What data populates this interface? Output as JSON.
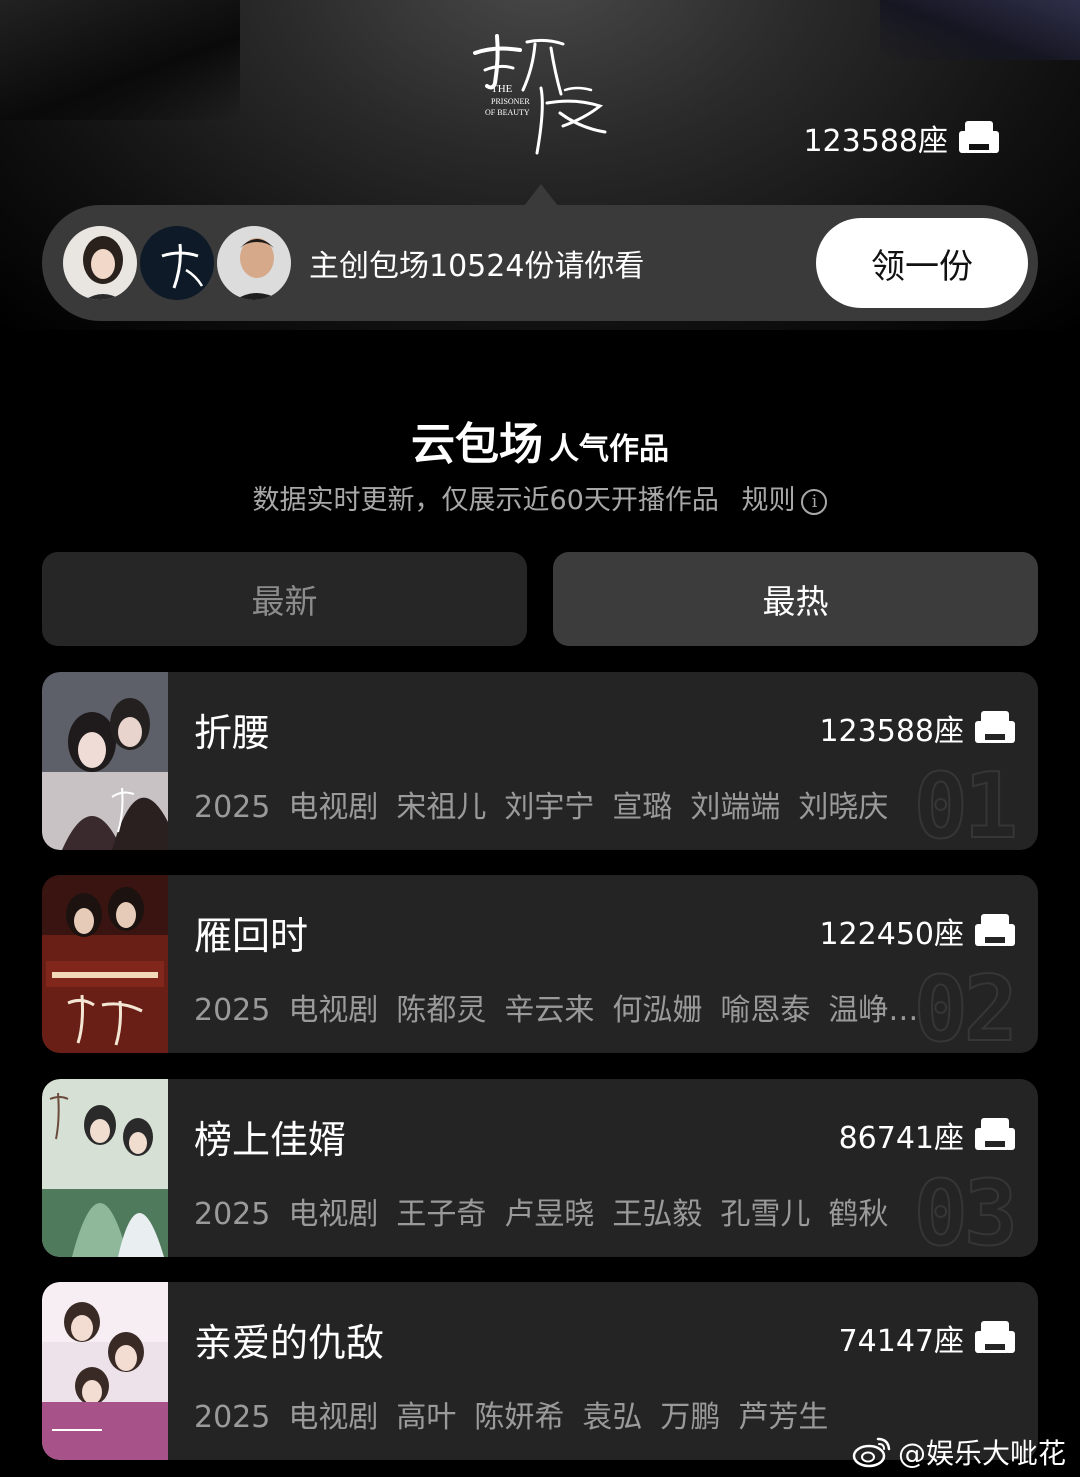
{
  "hero": {
    "logo_title": "折腰",
    "logo_subtitle": [
      "THE",
      "PRISONER",
      "OF BEAUTY"
    ],
    "seat_count": "123588座",
    "seat_icon": "sofa-icon"
  },
  "promo": {
    "text": "主创包场10524份请你看",
    "button_label": "领一份",
    "avatars": [
      "avatar-actress",
      "avatar-show-logo",
      "avatar-actor"
    ]
  },
  "section": {
    "title_big": "云包场",
    "title_small": "人气作品",
    "subtitle": "数据实时更新，仅展示近60天开播作品",
    "rules_label": "规则",
    "info_icon": "info-icon"
  },
  "tabs": [
    {
      "label": "最新",
      "active": false
    },
    {
      "label": "最热",
      "active": true
    }
  ],
  "list": [
    {
      "title": "折腰",
      "seats": "123588座",
      "rank": "01",
      "meta": [
        "2025",
        "电视剧",
        "宋祖儿",
        "刘宇宁",
        "宣璐",
        "刘端端",
        "刘晓庆"
      ],
      "poster_colors": [
        "#6b6e78",
        "#c9c4c6",
        "#3b2a30"
      ]
    },
    {
      "title": "雁回时",
      "seats": "122450座",
      "rank": "02",
      "meta": [
        "2025",
        "电视剧",
        "陈都灵",
        "辛云来",
        "何泓姗",
        "喻恩泰",
        "温峥…"
      ],
      "poster_colors": [
        "#3a1410",
        "#8a2a1c",
        "#c45a3a"
      ]
    },
    {
      "title": "榜上佳婿",
      "seats": "86741座",
      "rank": "03",
      "meta": [
        "2025",
        "电视剧",
        "王子奇",
        "卢昱晓",
        "王弘毅",
        "孔雪儿",
        "鹤秋"
      ],
      "poster_colors": [
        "#cfd9cf",
        "#7fa88c",
        "#3f6a4f"
      ]
    },
    {
      "title": "亲爱的仇敌",
      "seats": "74147座",
      "rank": "",
      "meta": [
        "2025",
        "电视剧",
        "高叶",
        "陈妍希",
        "袁弘",
        "万鹏",
        "芦芳生"
      ],
      "poster_colors": [
        "#e9dde6",
        "#b86aa0",
        "#6a2c5a"
      ]
    }
  ],
  "watermark": {
    "text": "@娱乐大呲花",
    "icon": "weibo-icon"
  }
}
